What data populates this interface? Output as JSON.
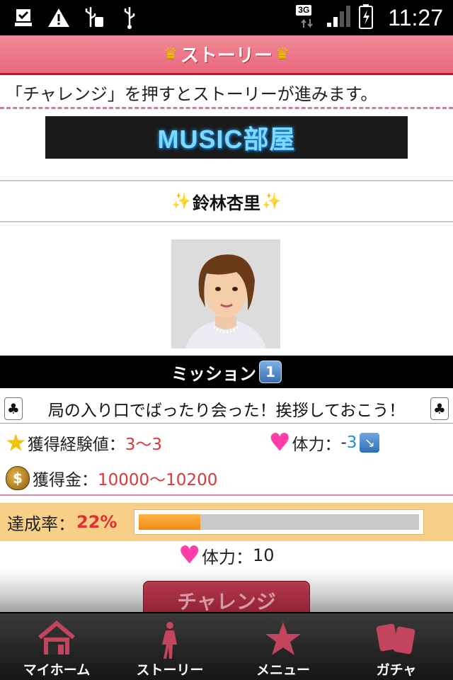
{
  "status_bar": {
    "network": "3G",
    "time": "11:27"
  },
  "header": {
    "title": "ストーリー"
  },
  "intro_text": "「チャレンジ」を押すとストーリーが進みます。",
  "banner": {
    "text": "MUSIC部屋"
  },
  "character": {
    "name": "鈴林杏里"
  },
  "mission": {
    "title": "ミッション",
    "number": "1",
    "description": "局の入り口でばったり会った！挨拶しておこう！",
    "exp_label": "獲得経験値：",
    "exp_value": "3〜3",
    "stamina_label": "体力：",
    "stamina_sign": "-",
    "stamina_value": "3",
    "money_label": "獲得金：",
    "money_value": "10000〜10200",
    "money_icon_text": "$"
  },
  "progress": {
    "label": "達成率：",
    "percent_text": "22%",
    "value": 0.22
  },
  "player_stamina": {
    "label": "体力：",
    "value": "10"
  },
  "challenge_button": {
    "label": "チャレンジ"
  },
  "tabs": [
    {
      "label": "マイホーム",
      "icon": "home-icon"
    },
    {
      "label": "ストーリー",
      "icon": "walking-person-icon"
    },
    {
      "label": "メニュー",
      "icon": "star-icon"
    },
    {
      "label": "ガチャ",
      "icon": "cards-icon"
    }
  ],
  "colors": {
    "accent": "#e8687c",
    "tab_icon": "#c2455d",
    "progress_fill": "#f08a10"
  }
}
